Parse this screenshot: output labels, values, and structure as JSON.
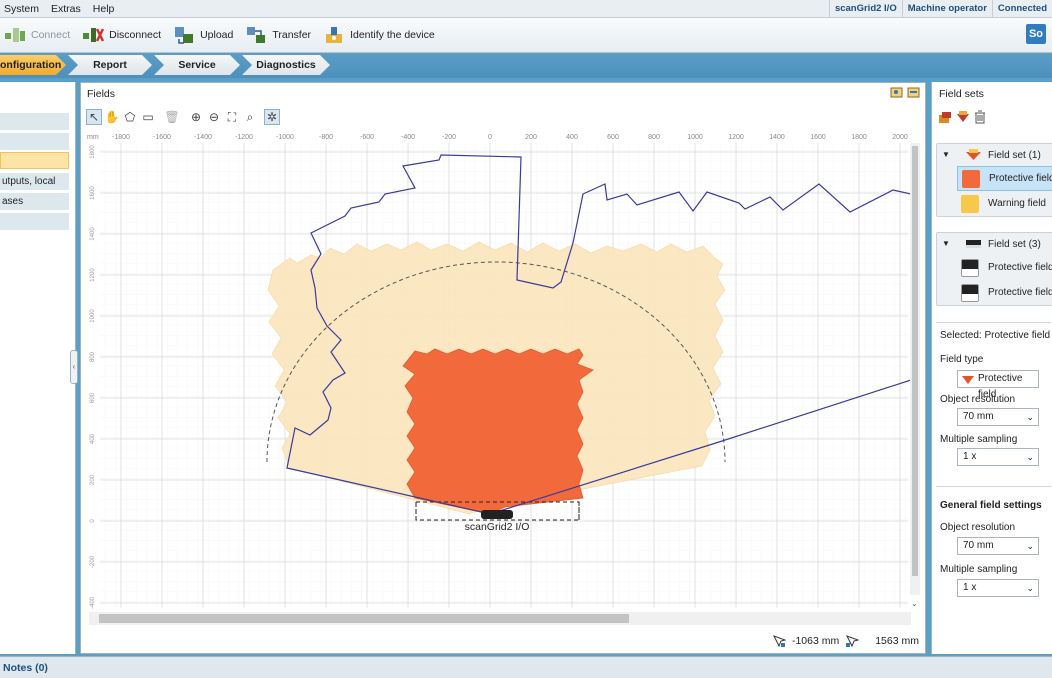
{
  "menu": {
    "items": [
      "System",
      "Extras",
      "Help"
    ]
  },
  "status": {
    "device": "scanGrid2 I/O",
    "role": "Machine operator",
    "connection": "Connected"
  },
  "toolbar": {
    "connect": "Connect",
    "disconnect": "Disconnect",
    "upload": "Upload",
    "transfer": "Transfer",
    "identify": "Identify the device",
    "logo": "So"
  },
  "tabs": [
    "Configuration",
    "Report",
    "Service",
    "Diagnostics"
  ],
  "tabs_visible": [
    "onfiguration",
    "Report",
    "Service",
    "Diagnostics"
  ],
  "left_nav": {
    "items": [
      "",
      "",
      "",
      "utputs, local",
      "ases",
      ""
    ],
    "selected_index": 2
  },
  "fields": {
    "title": "Fields",
    "device_label": "scanGrid2 I/O",
    "x_ticks": [
      "-1800",
      "-1600",
      "-1400",
      "-1200",
      "-1000",
      "-800",
      "-600",
      "-400",
      "-200",
      "0",
      "200",
      "400",
      "600",
      "800",
      "1000",
      "1200",
      "1400",
      "1600",
      "1800",
      "2000"
    ],
    "y_ticks": [
      "1800",
      "1600",
      "1400",
      "1200",
      "1000",
      "800",
      "600",
      "400",
      "200",
      "0",
      "-200",
      "-400"
    ],
    "ruler_unit": "mm",
    "coord_x": "-1063 mm",
    "coord_y": "1563 mm"
  },
  "field_sets": {
    "title": "Field sets",
    "groups": [
      {
        "name": "Field set (1)",
        "items": [
          {
            "label": "Protective field",
            "color": "#f26a3c",
            "selected": true
          },
          {
            "label": "Warning field",
            "color": "#f7c84a",
            "selected": false
          }
        ]
      },
      {
        "name": "Field set (3)",
        "items": [
          {
            "label": "Protective field",
            "color": "#2b2b2b",
            "selected": false
          },
          {
            "label": "Protective field",
            "color": "#2b2b2b",
            "selected": false
          }
        ]
      }
    ],
    "selected_label": "Selected: Protective field",
    "field_type_label": "Field type",
    "field_type_value": "Protective field",
    "object_resolution_label": "Object resolution",
    "object_resolution_value": "70 mm",
    "multiple_sampling_label": "Multiple sampling",
    "multiple_sampling_value": "1 x",
    "general_heading": "General field settings",
    "general_object_resolution_label": "Object resolution",
    "general_object_resolution_value": "70 mm",
    "general_multiple_sampling_label": "Multiple sampling",
    "general_multiple_sampling_value": "1 x"
  },
  "notes": {
    "label": "Notes (0)"
  },
  "colors": {
    "protective": "#f26a3c",
    "warning": "#fbe6bf",
    "contour": "#3b3a9c",
    "tab_active": "#f2a92b"
  }
}
